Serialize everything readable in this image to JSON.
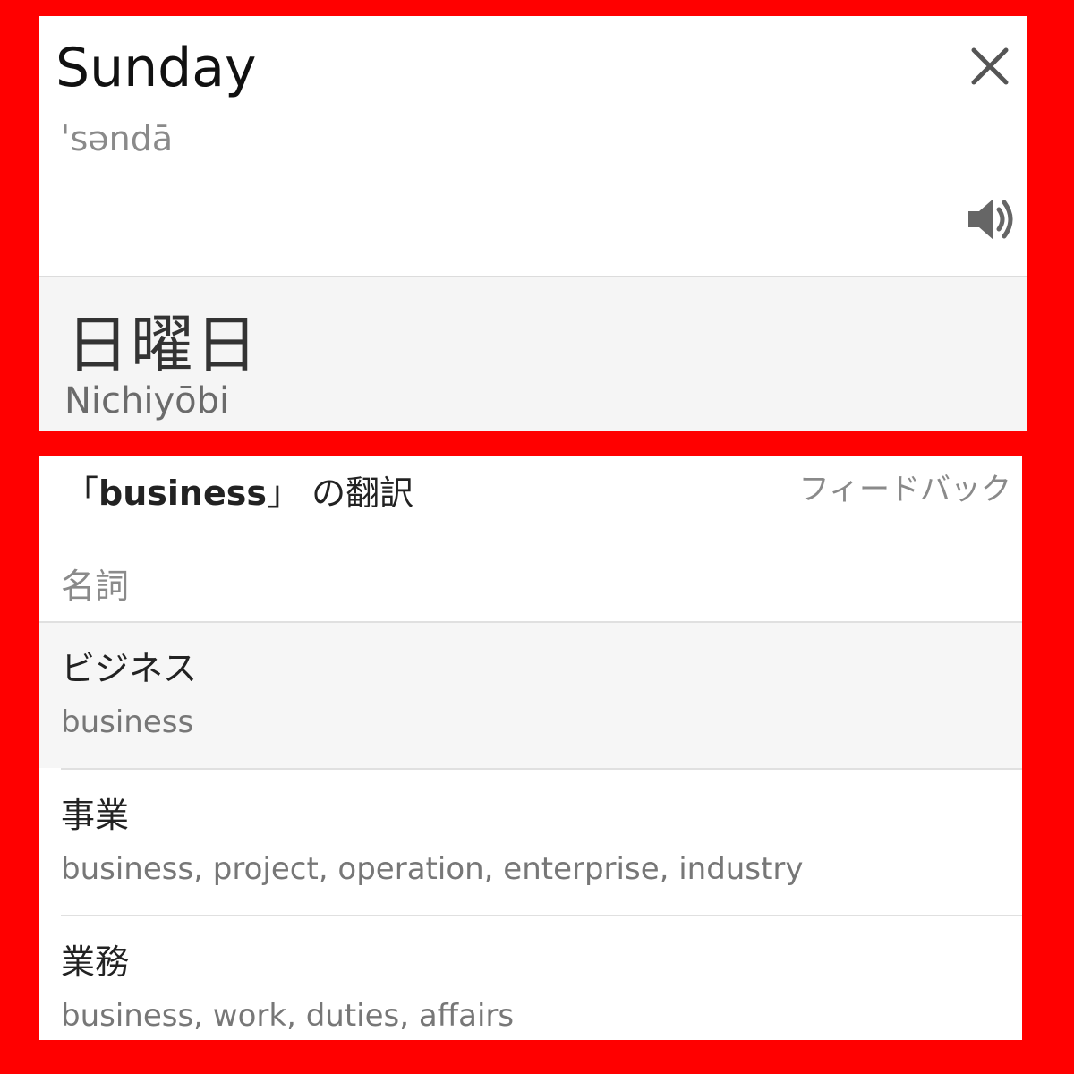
{
  "source": {
    "word": "Sunday",
    "pronunciation": "ˈsəndā"
  },
  "target": {
    "word": "日曜日",
    "transliteration": "Nichiyōbi"
  },
  "translations": {
    "heading_open": "「",
    "query": "business",
    "heading_close": "」 の翻訳",
    "feedback_label": "フィードバック",
    "part_of_speech": "名詞",
    "entries": [
      {
        "term": "ビジネス",
        "meanings": "business"
      },
      {
        "term": "事業",
        "meanings": "business, project, operation, enterprise, industry"
      },
      {
        "term": "業務",
        "meanings": "business, work, duties, affairs"
      }
    ]
  },
  "icons": {
    "close": "close-icon",
    "speaker": "speaker-icon"
  },
  "colors": {
    "frame": "#ff0000",
    "card": "#ffffff",
    "muted_text": "#8a8a8a"
  }
}
